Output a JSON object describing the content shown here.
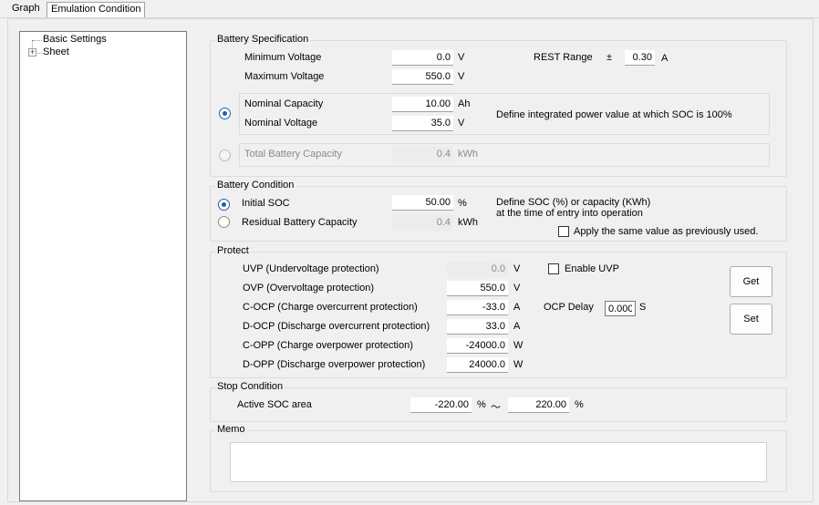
{
  "tabs": [
    {
      "label": "Graph",
      "active": false
    },
    {
      "label": "Emulation Condition",
      "active": true
    }
  ],
  "tree": {
    "items": [
      {
        "label": "Basic Settings"
      },
      {
        "label": "Sheet",
        "expander": "+"
      }
    ]
  },
  "battery_spec": {
    "title": "Battery Specification",
    "min_voltage": {
      "label": "Minimum Voltage",
      "value": "0.0",
      "unit": "V"
    },
    "max_voltage": {
      "label": "Maximum Voltage",
      "value": "550.0",
      "unit": "V"
    },
    "rest_range": {
      "label": "REST Range",
      "pm": "±",
      "value": "0.30",
      "unit": "A"
    },
    "nominal_capacity": {
      "label": "Nominal Capacity",
      "value": "10.00",
      "unit": "Ah"
    },
    "nominal_voltage": {
      "label": "Nominal Voltage",
      "value": "35.0",
      "unit": "V"
    },
    "define_note": "Define integrated power value at which SOC is 100%",
    "total_capacity": {
      "label": "Total Battery Capacity",
      "value": "0.4",
      "unit": "kWh"
    },
    "selected_mode": "nominal"
  },
  "battery_condition": {
    "title": "Battery Condition",
    "initial_soc": {
      "label": "Initial SOC",
      "value": "50.00",
      "unit": "%"
    },
    "residual_capacity": {
      "label": "Residual Battery Capacity",
      "value": "0.4",
      "unit": "kWh"
    },
    "note_line1": "Define SOC (%) or capacity (KWh)",
    "note_line2": "at the time of entry into operation",
    "apply_same_label": "Apply the same value as previously used.",
    "apply_same_checked": false,
    "selected_mode": "initial_soc"
  },
  "protect": {
    "title": "Protect",
    "uvp": {
      "label": "UVP (Undervoltage protection)",
      "value": "0.0",
      "unit": "V"
    },
    "ovp": {
      "label": "OVP (Overvoltage protection)",
      "value": "550.0",
      "unit": "V"
    },
    "cocp": {
      "label": "C-OCP (Charge overcurrent protection)",
      "value": "-33.0",
      "unit": "A"
    },
    "docp": {
      "label": "D-OCP (Discharge overcurrent protection)",
      "value": "33.0",
      "unit": "A"
    },
    "copp": {
      "label": "C-OPP (Charge overpower protection)",
      "value": "-24000.0",
      "unit": "W"
    },
    "dopp": {
      "label": "D-OPP (Discharge overpower protection)",
      "value": "24000.0",
      "unit": "W"
    },
    "enable_uvp_label": "Enable UVP",
    "enable_uvp_checked": false,
    "ocp_delay": {
      "label": "OCP Delay",
      "value": "0.000",
      "unit": "S"
    },
    "get_label": "Get",
    "set_label": "Set"
  },
  "stop_condition": {
    "title": "Stop Condition",
    "active_soc": {
      "label": "Active SOC area",
      "min": "-220.00",
      "min_unit": "%",
      "tilde": "～",
      "max": "220.00",
      "max_unit": "%"
    }
  },
  "memo": {
    "title": "Memo",
    "value": ""
  }
}
